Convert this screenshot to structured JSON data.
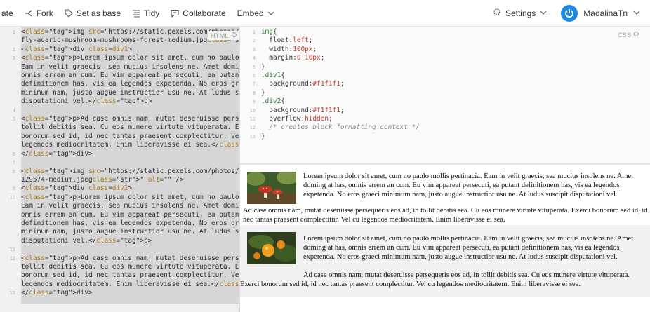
{
  "toolbar": {
    "items": [
      {
        "label": "ate",
        "icon": "none"
      },
      {
        "label": "Fork",
        "icon": "fork-icon"
      },
      {
        "label": "Set as base",
        "icon": "tag-icon"
      },
      {
        "label": "Tidy",
        "icon": "tidy-icon"
      },
      {
        "label": "Collaborate",
        "icon": "chat-icon"
      },
      {
        "label": "Embed",
        "icon": "chevron-down-icon"
      }
    ],
    "settings_label": "Settings",
    "username": "MadalinaTn"
  },
  "html_panel": {
    "badge": "HTML",
    "lines": [
      {
        "n": "1",
        "text": "<img src=\"https://static.pexels.com/photos/33695/matryoshka-"
      },
      {
        "n": "",
        "text": "fly-agaric-mushroom-mushrooms-forest-medium.jpg\" alt=\"\" />"
      },
      {
        "n": "2",
        "text": "<div class=div1>"
      },
      {
        "n": "3",
        "text": "<p>Lorem ipsum dolor sit amet, cum no paulo mollis pertinacia."
      },
      {
        "n": "",
        "text": "Eam in velit graecis, sea mucius insolens ne. Amet doming at has,"
      },
      {
        "n": "",
        "text": "omnis errem an cum. Eu vim appareat persecuti, ea putant"
      },
      {
        "n": "",
        "text": "definitionem has, vis ea legendos expetenda. No eros graeci"
      },
      {
        "n": "",
        "text": "minimum nam, justo augue instructior usu ne. At ludus suscipit"
      },
      {
        "n": "",
        "text": "disputationi vel.</p>"
      },
      {
        "n": "4",
        "text": ""
      },
      {
        "n": "5",
        "text": "<p>Ad case omnis nam, mutat deseruisse persequeris eos ad, in"
      },
      {
        "n": "",
        "text": "tollit debitis sea. Cu eos munere virtute vituperata. Exerci"
      },
      {
        "n": "",
        "text": "bonorum sed id, id nec tantas praesent complectitur. Vel cu"
      },
      {
        "n": "",
        "text": "legendos mediocritatem. Enim liberavisse ei sea.</p>"
      },
      {
        "n": "6",
        "text": "</div>"
      },
      {
        "n": "7",
        "text": ""
      },
      {
        "n": "8",
        "text": "<img src=\"https://static.pexels.com/photos/129574/pexels-photo-"
      },
      {
        "n": "",
        "text": "129574-medium.jpeg\" alt=\"\" />"
      },
      {
        "n": "9",
        "text": "<div class=div2>"
      },
      {
        "n": "10",
        "text": "<p>Lorem ipsum dolor sit amet, cum no paulo mollis pertinacia."
      },
      {
        "n": "",
        "text": "Eam in velit graecis, sea mucius insolens ne. Amet doming at has,"
      },
      {
        "n": "",
        "text": "omnis errem an cum. Eu vim appareat persecuti, ea putant"
      },
      {
        "n": "",
        "text": "definitionem has, vis ea legendos expetenda. No eros graeci"
      },
      {
        "n": "",
        "text": "minimum nam, justo augue instructior usu ne. At ludus suscipit"
      },
      {
        "n": "",
        "text": "disputationi vel.</p>"
      },
      {
        "n": "11",
        "text": ""
      },
      {
        "n": "12",
        "text": "<p>Ad case omnis nam, mutat deseruisse persequeris eos ad, in"
      },
      {
        "n": "",
        "text": "tollit debitis sea. Cu eos munere virtute vituperata. Exerci"
      },
      {
        "n": "",
        "text": "bonorum sed id, id nec tantas praesent complectitur. Vel cu"
      },
      {
        "n": "",
        "text": "legendos mediocritatem. Enim liberavisse ei sea.</p>"
      },
      {
        "n": "13",
        "text": "</div>"
      }
    ]
  },
  "css_panel": {
    "badge": "CSS",
    "lines": [
      {
        "n": "1",
        "text": "img{"
      },
      {
        "n": "2",
        "text": "  float:left;"
      },
      {
        "n": "3",
        "text": "  width:100px;"
      },
      {
        "n": "4",
        "text": "  margin:0 10px;"
      },
      {
        "n": "5",
        "text": "}"
      },
      {
        "n": "6",
        "text": ".div1{"
      },
      {
        "n": "7",
        "text": "  background:#f1f1f1;"
      },
      {
        "n": "8",
        "text": "}"
      },
      {
        "n": "9",
        "text": ".div2{"
      },
      {
        "n": "10",
        "text": "  background:#f1f1f1;"
      },
      {
        "n": "11",
        "text": "  overflow:hidden;"
      },
      {
        "n": "12",
        "text": "  /* creates block formatting context */"
      },
      {
        "n": "13",
        "text": "}"
      }
    ]
  },
  "result": {
    "div1_p1": "Lorem ipsum dolor sit amet, cum no paulo mollis pertinacia. Eam in velit graecis, sea mucius insolens ne. Amet doming at has, omnis errem an cum. Eu vim appareat persecuti, ea putant definitionem has, vis ea legendos expetenda. No eros graeci minimum nam, justo augue instructior usu ne. At ludus suscipit disputationi vel.",
    "div1_p2": "Ad case omnis nam, mutat deseruisse persequeris eos ad, in tollit debitis sea. Cu eos munere virtute vituperata. Exerci bonorum sed id, id nec tantas praesent complectitur. Vel cu legendos mediocritatem. Enim liberavisse ei sea.",
    "div2_p1": "Lorem ipsum dolor sit amet, cum no paulo mollis pertinacia. Eam in velit graecis, sea mucius insolens ne. Amet doming at has, omnis errem an cum. Eu vim appareat persecuti, ea putant definitionem has, vis ea legendos expetenda. No eros graeci minimum nam, justo augue instructior usu ne. At ludus suscipit disputationi vel.",
    "div2_p2": "Ad case omnis nam, mutat deseruisse persequeris eos ad, in tollit debitis sea. Cu eos munere virtute vituperata. Exerci bonorum sed id, id nec tantas praesent complectitur. Vel cu legendos mediocritatem. Enim liberavisse ei sea."
  },
  "colors": {
    "accent": "#1e88e5",
    "selection": "#d6d6d6",
    "result_block_bg": "#f1f1f1"
  }
}
